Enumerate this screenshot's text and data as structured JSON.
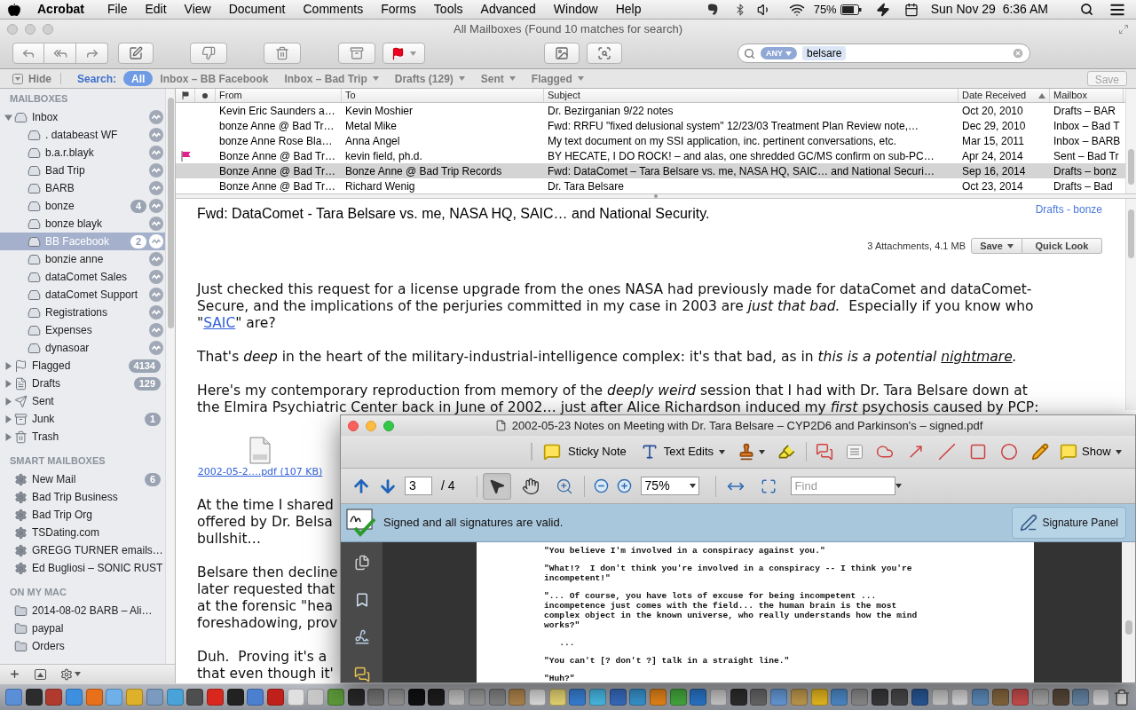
{
  "menubar": {
    "app": "Acrobat",
    "menus": [
      "File",
      "Edit",
      "View",
      "Document",
      "Comments",
      "Forms",
      "Tools",
      "Advanced",
      "Window",
      "Help"
    ],
    "battery": "75%",
    "clock": "Sun Nov 29  6:36 AM"
  },
  "mail_window": {
    "title": "All Mailboxes (Found 10 matches for search)",
    "search": {
      "token": "ANY",
      "value": "belsare"
    },
    "scope_bar": {
      "hide": "Hide",
      "label": "Search:",
      "scopes": [
        {
          "label": "All",
          "selected": true,
          "has_menu": false
        },
        {
          "label": "Inbox – BB Facebook",
          "selected": false,
          "has_menu": false
        },
        {
          "label": "Inbox – Bad Trip",
          "selected": false,
          "has_menu": true
        },
        {
          "label": "Drafts (129)",
          "selected": false,
          "has_menu": true
        },
        {
          "label": "Sent",
          "selected": false,
          "has_menu": true
        },
        {
          "label": "Flagged",
          "selected": false,
          "has_menu": true
        }
      ],
      "save": {
        "label": "Save",
        "disabled": true
      }
    },
    "sidebar": {
      "sections": [
        {
          "title": "MAILBOXES",
          "items": [
            {
              "label": "Inbox",
              "kind": "mailbox",
              "selected": false,
              "expanded": true,
              "children": [
                {
                  "label": ". databeast WF",
                  "kind": "mailbox",
                  "selected": false
                },
                {
                  "label": "b.a.r.blayk",
                  "kind": "mailbox",
                  "selected": false
                },
                {
                  "label": "Bad Trip",
                  "kind": "mailbox",
                  "selected": false
                },
                {
                  "label": "BARB",
                  "kind": "mailbox",
                  "selected": false
                },
                {
                  "label": "bonze",
                  "kind": "mailbox",
                  "selected": false,
                  "count": "4"
                },
                {
                  "label": "bonze blayk",
                  "kind": "mailbox",
                  "selected": false
                },
                {
                  "label": "BB Facebook",
                  "kind": "mailbox",
                  "selected": true,
                  "count": "2"
                },
                {
                  "label": "bonzie anne",
                  "kind": "mailbox",
                  "selected": false
                },
                {
                  "label": "dataComet Sales",
                  "kind": "mailbox",
                  "selected": false
                },
                {
                  "label": "dataComet Support",
                  "kind": "mailbox",
                  "selected": false
                },
                {
                  "label": "Registrations",
                  "kind": "mailbox",
                  "selected": false
                },
                {
                  "label": "Expenses",
                  "kind": "mailbox",
                  "selected": false
                },
                {
                  "label": "dynasoar",
                  "kind": "mailbox",
                  "selected": false
                }
              ]
            },
            {
              "label": "Flagged",
              "kind": "flagged",
              "selected": false,
              "expanded": false,
              "count": "4134"
            },
            {
              "label": "Drafts",
              "kind": "drafts",
              "selected": false,
              "expanded": false,
              "count": "129"
            },
            {
              "label": "Sent",
              "kind": "sent",
              "selected": false,
              "expanded": false
            },
            {
              "label": "Junk",
              "kind": "junk",
              "selected": false,
              "expanded": false,
              "count": "1"
            },
            {
              "label": "Trash",
              "kind": "trash",
              "selected": false,
              "expanded": false
            }
          ]
        },
        {
          "title": "SMART MAILBOXES",
          "items": [
            {
              "label": "New Mail",
              "kind": "smart",
              "selected": false,
              "count": "6"
            },
            {
              "label": "Bad Trip Business",
              "kind": "smart",
              "selected": false
            },
            {
              "label": "Bad Trip Org",
              "kind": "smart",
              "selected": false
            },
            {
              "label": "TSDating.com",
              "kind": "smart",
              "selected": false
            },
            {
              "label": "GREGG TURNER emails…",
              "kind": "smart",
              "selected": false
            },
            {
              "label": "Ed Bugliosi – SONIC RUST",
              "kind": "smart",
              "selected": false
            }
          ]
        },
        {
          "title": "ON MY MAC",
          "items": [
            {
              "label": "2014-08-02 BARB – Ali…",
              "kind": "folder",
              "selected": false
            },
            {
              "label": "paypal",
              "kind": "folder",
              "selected": false
            },
            {
              "label": "Orders",
              "kind": "folder",
              "selected": false
            }
          ]
        }
      ]
    },
    "message_list": {
      "columns": [
        {
          "label": "From",
          "sorted": false
        },
        {
          "label": "To",
          "sorted": false
        },
        {
          "label": "Subject",
          "sorted": false
        },
        {
          "label": "Date Received",
          "sorted": true
        },
        {
          "label": "Mailbox",
          "sorted": false
        }
      ],
      "rows": [
        {
          "flagged": false,
          "selected": false,
          "from": "Kevin Eric Saunders a…",
          "to": "Kevin Moshier",
          "subject": "Dr. Bezirganian 9/22 notes",
          "date": "Oct 20, 2010",
          "mailbox": "Drafts – BAR"
        },
        {
          "flagged": false,
          "selected": false,
          "from": "bonze Anne @ Bad Tr…",
          "to": "Metal Mike",
          "subject": "Fwd: RRFU \"fixed delusional system\" 12/23/03 Treatment Plan Review note,…",
          "date": "Dec 29, 2010",
          "mailbox": "Inbox – Bad T"
        },
        {
          "flagged": false,
          "selected": false,
          "from": "bonze Anne Rose Bla…",
          "to": "Anna Angel",
          "subject": "My text document on my SSI application, inc. pertinent conversations, etc.",
          "date": "Mar 15, 2011",
          "mailbox": "Inbox – BARB"
        },
        {
          "flagged": true,
          "selected": false,
          "from": "Bonze Anne @ Bad Tr…",
          "to": "kevin field, ph.d.",
          "subject": "BY HECATE, I DO ROCK! – and alas, one shredded GC/MS confirm on sub-PC…",
          "date": "Apr 24, 2014",
          "mailbox": "Sent – Bad Tr"
        },
        {
          "flagged": false,
          "selected": true,
          "from": "Bonze Anne @ Bad Tr…",
          "to": "Bonze Anne @ Bad Trip Records",
          "subject": "Fwd: DataComet – Tara Belsare vs. me, NASA HQ, SAIC… and National Securi…",
          "date": "Sep 16, 2014",
          "mailbox": "Drafts – bonz"
        },
        {
          "flagged": false,
          "selected": false,
          "from": "Bonze Anne @ Bad Tr…",
          "to": "Richard Wenig",
          "subject": "Dr. Tara Belsare",
          "date": "Oct 23, 2014",
          "mailbox": "Drafts – Bad"
        }
      ]
    },
    "message": {
      "subject": "Fwd: DataComet - Tara Belsare vs. me, NASA HQ, SAIC… and National Security.",
      "mailbox_link": "Drafts - bonze",
      "attachments_summary": "3 Attachments, 4.1 MB",
      "save": "Save",
      "quick_look": "Quick Look",
      "paragraphs": [
        [
          {
            "text": "Just checked this request for a license upgrade from the ones NASA had previously made for dataComet and dataComet-Secure, and the implications of the perjuries committed in my case in 2003 are ",
            "kind": "plain"
          },
          {
            "text": "just that bad.",
            "kind": "italic"
          },
          {
            "text": "  Especially if you know who \"",
            "kind": "plain"
          },
          {
            "text": "SAIC",
            "kind": "link"
          },
          {
            "text": "\" are?",
            "kind": "plain"
          }
        ],
        [
          {
            "text": "That's ",
            "kind": "plain"
          },
          {
            "text": "deep",
            "kind": "italic"
          },
          {
            "text": " in the heart of the military-industrial-intelligence complex: it's that bad, as in ",
            "kind": "plain"
          },
          {
            "text": "this is a potential ",
            "kind": "italic"
          },
          {
            "text": "nightmare",
            "kind": "italic_underline"
          },
          {
            "text": ".",
            "kind": "italic"
          }
        ],
        [
          {
            "text": "Here's my contemporary reproduction from memory of the ",
            "kind": "plain"
          },
          {
            "text": "deeply weird",
            "kind": "italic"
          },
          {
            "text": " session that I had with Dr. Tara Belsare down at the Elmira Psychiatric Center back in June of 2002… just after Alice Richardson induced my ",
            "kind": "plain"
          },
          {
            "text": "first",
            "kind": "italic"
          },
          {
            "text": " psychosis caused by PCP:",
            "kind": "plain"
          }
        ]
      ],
      "attachment": "2002-05-2….pdf (107 KB)",
      "covered_paragraphs": [
        [
          "At the time I shared",
          "offered by Dr. Belsa",
          "bullshit…"
        ],
        [
          "Belsare then decline",
          "later requested that",
          "at the forensic \"hea",
          "foreshadowing, prov"
        ],
        [
          "Duh.  Proving it's a",
          "that even though it'"
        ]
      ]
    }
  },
  "pdf_window": {
    "title": "2002-05-23 Notes on Meeting with Dr. Tara Belsare – CYP2D6 and Parkinson's – signed.pdf",
    "sticky_note": "Sticky Note",
    "text_edits": "Text Edits",
    "show": "Show",
    "page": "3",
    "page_total": "/ 4",
    "nav_tools": [
      {
        "kind": "select",
        "selected": true
      },
      {
        "kind": "hand",
        "selected": false
      },
      {
        "kind": "zoom",
        "selected": false
      }
    ],
    "zoom": "75%",
    "find_placeholder": "Find",
    "signature_status": "Signed and all signatures are valid.",
    "signature_panel": "Signature Panel",
    "page_text": [
      "\"You believe I'm involved in a conspiracy against you.\"",
      "\"What!?  I don't think you're involved in a conspiracy -- I think you're\nincompetent!\"",
      "\"... Of course, you have lots of excuse for being incompetent ...\nincompetence just comes with the field... the human brain is the most\ncomplex object in the known universe, who really understands how the mind\nworks?\"",
      "   ...",
      "\"You can't [? don't ?] talk in a straight line.\"",
      "\"Huh?\""
    ]
  }
}
